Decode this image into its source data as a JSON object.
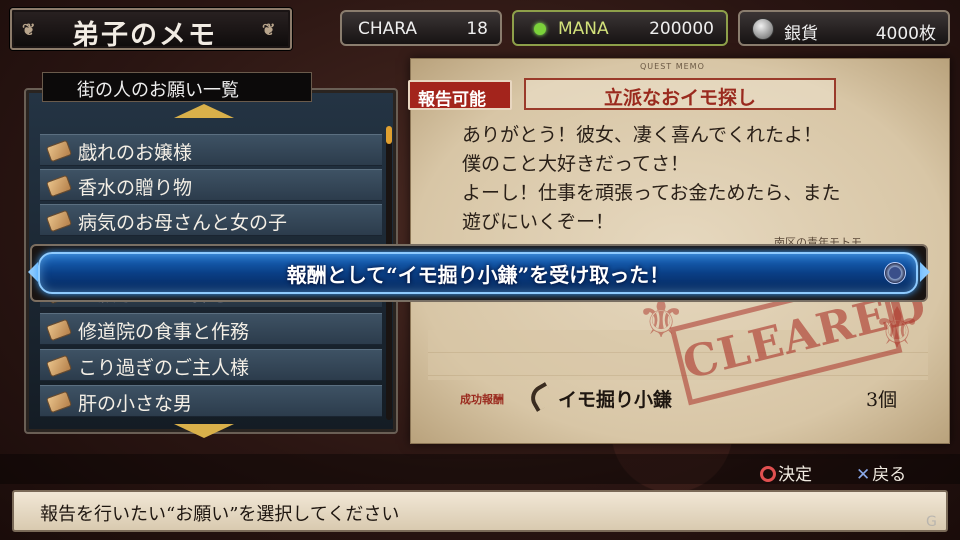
{
  "screen_title": "弟子のメモ",
  "stats": {
    "chara_label": "CHARA",
    "chara_value": "18",
    "mana_label": "MANA",
    "mana_value": "200000",
    "coin_label": "銀貨",
    "coin_value": "4000枚"
  },
  "list": {
    "header": "街の人のお願い一覧",
    "items": [
      "戯れのお嬢様",
      "香水の贈り物",
      "病気のお母さんと女の子",
      "立派なおイモ探し",
      "修道院の食事と作務",
      "こり過ぎのご主人様",
      "肝の小さな男"
    ]
  },
  "memo": {
    "header": "QUEST MEMO",
    "badge": "報告可能",
    "title": "立派なおイモ探し",
    "lines": [
      "ありがとう！彼女、凄く喜んでくれたよ！",
      "僕のこと大好きだってさ！",
      "よーし！仕事を頑張ってお金ためたら、また",
      "遊びにいくぞー！"
    ],
    "signature": "南区の青年モトモ",
    "stamp": "CLEARED",
    "reward_label": "成功報酬",
    "reward_item": "イモ掘り小鎌",
    "reward_qty": "3個"
  },
  "notification": "報酬として“イモ掘り小鎌”を受け取った！",
  "controls": {
    "confirm": "決定",
    "back": "戻る"
  },
  "help_text": "報告を行いたい“お願い”を選択してください",
  "watermark": "G"
}
